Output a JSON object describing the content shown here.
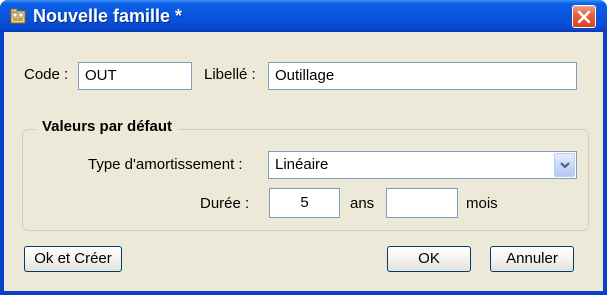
{
  "window": {
    "title": "Nouvelle famille *",
    "icon": "folder-document-icon",
    "close_icon": "close-x-icon"
  },
  "form": {
    "code": {
      "label": "Code :",
      "value": "OUT"
    },
    "libelle": {
      "label": "Libellé :",
      "value": "Outillage"
    }
  },
  "defaults": {
    "legend": "Valeurs par défaut",
    "amortissement": {
      "label": "Type d'amortissement :",
      "selected": "Linéaire"
    },
    "duree": {
      "label": "Durée :",
      "years_value": "5",
      "years_unit": "ans",
      "months_value": "",
      "months_unit": "mois"
    }
  },
  "buttons": {
    "ok_create": "Ok et Créer",
    "ok": "OK",
    "cancel": "Annuler"
  },
  "colors": {
    "titlebar": "#0b55de",
    "dialog_background": "#ece9d8",
    "close_button": "#d3431e"
  }
}
